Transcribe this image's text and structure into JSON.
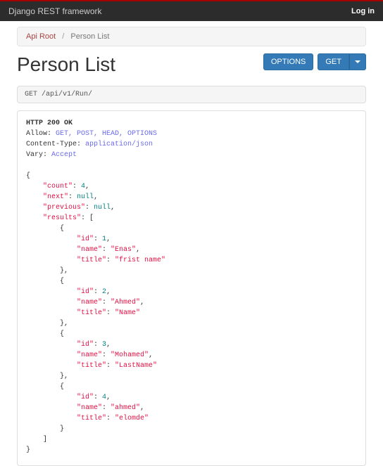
{
  "topbar": {
    "brand": "Django REST framework",
    "login": "Log in"
  },
  "breadcrumb": {
    "root": "Api Root",
    "separator": "/",
    "current": "Person List"
  },
  "page": {
    "title": "Person List"
  },
  "buttons": {
    "options": "OPTIONS",
    "get": "GET"
  },
  "request": {
    "line": "GET /api/v1/Run/"
  },
  "response": {
    "status": "HTTP 200 OK",
    "headers": {
      "allow_key": "Allow:",
      "allow_val": "GET, POST, HEAD, OPTIONS",
      "ctype_key": "Content-Type:",
      "ctype_val": "application/json",
      "vary_key": "Vary:",
      "vary_val": "Accept"
    },
    "body": {
      "count": 4,
      "next": "null",
      "previous": "null",
      "results": [
        {
          "id": 1,
          "name": "Enas",
          "title": "frist name"
        },
        {
          "id": 2,
          "name": "Ahmed",
          "title": "Name"
        },
        {
          "id": 3,
          "name": "Mohamed",
          "title": "LastName"
        },
        {
          "id": 4,
          "name": "ahmed",
          "title": "elomde"
        }
      ]
    }
  }
}
